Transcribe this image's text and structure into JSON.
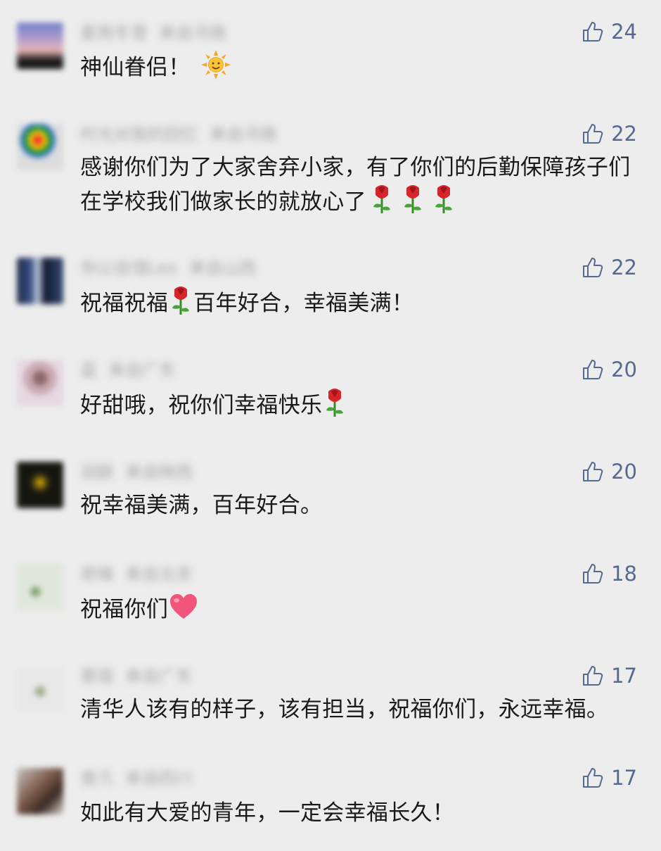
{
  "comments": [
    {
      "name": "夏雨冬雪",
      "location": "来自河南",
      "likes": "24",
      "text": "神仙眷侣！",
      "emoji": [
        "sun"
      ]
    },
    {
      "name": "时光对我的回忆",
      "location": "来自河南",
      "likes": "22",
      "text": "感谢你们为了大家舍弃小家，有了你们的后勤保障孩子们在学校我们做家长的就放心了",
      "emoji": [
        "rose",
        "rose",
        "rose"
      ]
    },
    {
      "name": "你以自惜Leo",
      "location": "来自山西",
      "likes": "22",
      "text_before": "祝福祝福",
      "text_after": "百年好合，幸福美满！",
      "emoji": [
        "rose"
      ]
    },
    {
      "name": "蓝",
      "location": "来自广东",
      "likes": "20",
      "text": "好甜哦，祝你们幸福快乐",
      "emoji": [
        "rose"
      ]
    },
    {
      "name": "润颖",
      "location": "来自陕西",
      "likes": "20",
      "text": "祝幸福美满，百年好合。",
      "emoji": []
    },
    {
      "name": "奇锋",
      "location": "来自北京",
      "likes": "18",
      "text": "祝福你们",
      "emoji": [
        "heart"
      ]
    },
    {
      "name": "景瑶",
      "location": "来自广东",
      "likes": "17",
      "text": "清华人该有的样子，该有担当，祝福你们，永远幸福。",
      "emoji": []
    },
    {
      "name": "曾凡",
      "location": "来自四川",
      "likes": "17",
      "text": "如此有大爱的青年，一定会幸福长久！",
      "emoji": []
    }
  ],
  "icons": {
    "like": "thumbs-up-icon"
  },
  "colors": {
    "background": "#ededed",
    "like_count": "#56698f",
    "text": "#1a1a1a"
  }
}
